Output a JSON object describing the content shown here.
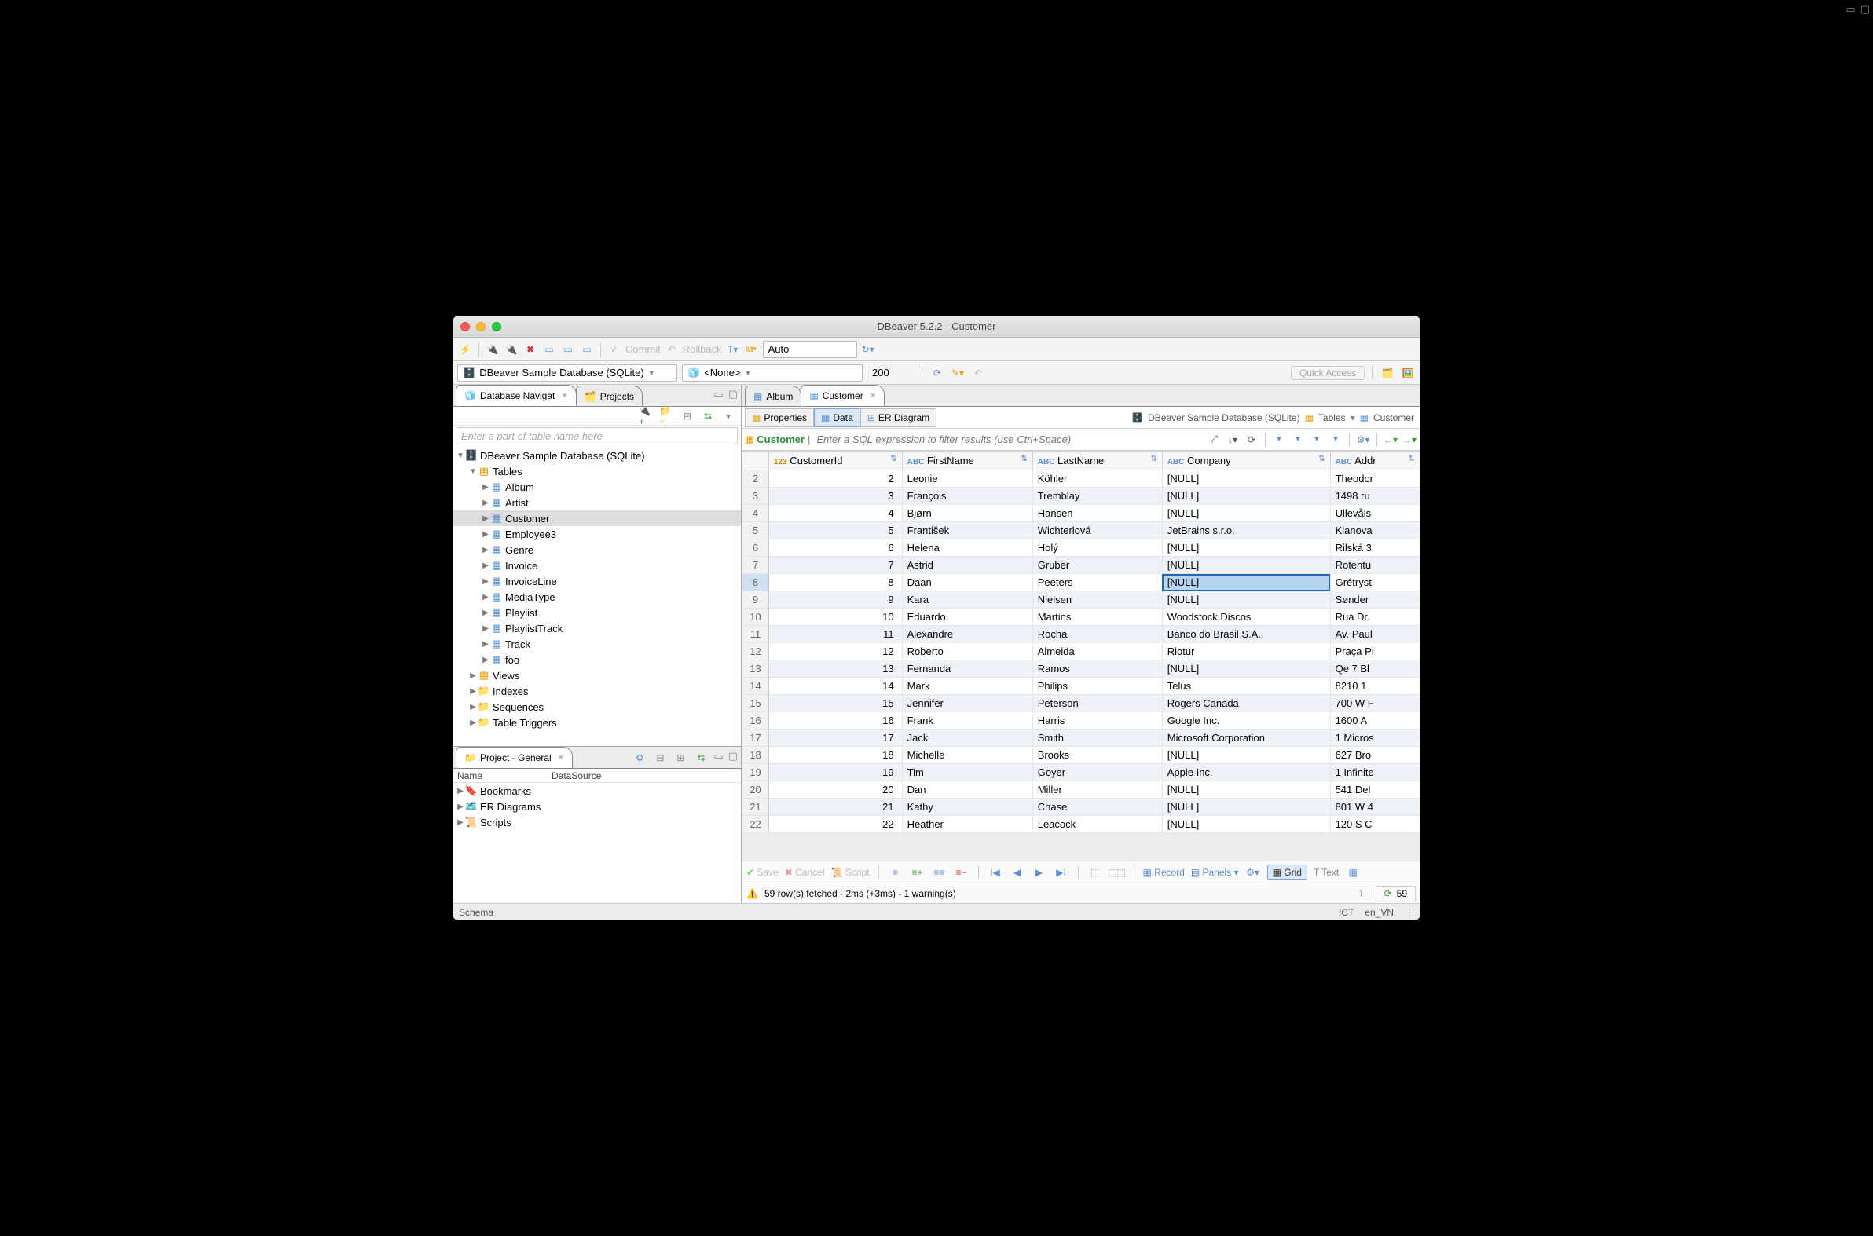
{
  "window": {
    "title": "DBeaver 5.2.2 - Customer"
  },
  "toolbar": {
    "commit": "Commit",
    "rollback": "Rollback",
    "tx_mode": "Auto",
    "datasource": "DBeaver Sample Database (SQLite)",
    "schema": "<None>",
    "fetch_size": "200",
    "quick_access": "Quick Access"
  },
  "nav": {
    "tab1": "Database Navigat",
    "tab2": "Projects",
    "search_ph": "Enter a part of table name here",
    "root": "DBeaver Sample Database (SQLite)",
    "tables_label": "Tables",
    "tables": [
      "Album",
      "Artist",
      "Customer",
      "Employee3",
      "Genre",
      "Invoice",
      "InvoiceLine",
      "MediaType",
      "Playlist",
      "PlaylistTrack",
      "Track",
      "foo"
    ],
    "views": "Views",
    "indexes": "Indexes",
    "sequences": "Sequences",
    "triggers": "Table Triggers"
  },
  "project": {
    "title": "Project - General",
    "col_name": "Name",
    "col_ds": "DataSource",
    "items": [
      "Bookmarks",
      "ER Diagrams",
      "Scripts"
    ]
  },
  "editor": {
    "tabs": [
      {
        "label": "Album",
        "active": false
      },
      {
        "label": "Customer",
        "active": true
      }
    ],
    "subtabs": {
      "properties": "Properties",
      "data": "Data",
      "er": "ER Diagram"
    },
    "breadcrumb": {
      "db": "DBeaver Sample Database (SQLite)",
      "tables": "Tables",
      "table": "Customer"
    },
    "filter_label": "Customer",
    "filter_ph": "Enter a SQL expression to filter results (use Ctrl+Space)"
  },
  "grid": {
    "columns": [
      "CustomerId",
      "FirstName",
      "LastName",
      "Company",
      "Addr"
    ],
    "col_types": [
      "123",
      "ABC",
      "ABC",
      "ABC",
      "ABC"
    ],
    "selected_row": 8,
    "selected_col": 3,
    "rows": [
      {
        "n": 2,
        "CustomerId": 2,
        "FirstName": "Leonie",
        "LastName": "Köhler",
        "Company": "[NULL]",
        "Addr": "Theodor"
      },
      {
        "n": 3,
        "CustomerId": 3,
        "FirstName": "François",
        "LastName": "Tremblay",
        "Company": "[NULL]",
        "Addr": "1498 ru"
      },
      {
        "n": 4,
        "CustomerId": 4,
        "FirstName": "Bjørn",
        "LastName": "Hansen",
        "Company": "[NULL]",
        "Addr": "Ullevåls"
      },
      {
        "n": 5,
        "CustomerId": 5,
        "FirstName": "František",
        "LastName": "Wichterlová",
        "Company": "JetBrains s.r.o.",
        "Addr": "Klanova"
      },
      {
        "n": 6,
        "CustomerId": 6,
        "FirstName": "Helena",
        "LastName": "Holý",
        "Company": "[NULL]",
        "Addr": "Rilská 3"
      },
      {
        "n": 7,
        "CustomerId": 7,
        "FirstName": "Astrid",
        "LastName": "Gruber",
        "Company": "[NULL]",
        "Addr": "Rotentu"
      },
      {
        "n": 8,
        "CustomerId": 8,
        "FirstName": "Daan",
        "LastName": "Peeters",
        "Company": "[NULL]",
        "Addr": "Grétryst"
      },
      {
        "n": 9,
        "CustomerId": 9,
        "FirstName": "Kara",
        "LastName": "Nielsen",
        "Company": "[NULL]",
        "Addr": "Sønder"
      },
      {
        "n": 10,
        "CustomerId": 10,
        "FirstName": "Eduardo",
        "LastName": "Martins",
        "Company": "Woodstock Discos",
        "Addr": "Rua Dr."
      },
      {
        "n": 11,
        "CustomerId": 11,
        "FirstName": "Alexandre",
        "LastName": "Rocha",
        "Company": "Banco do Brasil S.A.",
        "Addr": "Av. Paul"
      },
      {
        "n": 12,
        "CustomerId": 12,
        "FirstName": "Roberto",
        "LastName": "Almeida",
        "Company": "Riotur",
        "Addr": "Praça Pi"
      },
      {
        "n": 13,
        "CustomerId": 13,
        "FirstName": "Fernanda",
        "LastName": "Ramos",
        "Company": "[NULL]",
        "Addr": "Qe 7 Bl"
      },
      {
        "n": 14,
        "CustomerId": 14,
        "FirstName": "Mark",
        "LastName": "Philips",
        "Company": "Telus",
        "Addr": "8210 1"
      },
      {
        "n": 15,
        "CustomerId": 15,
        "FirstName": "Jennifer",
        "LastName": "Peterson",
        "Company": "Rogers Canada",
        "Addr": "700 W F"
      },
      {
        "n": 16,
        "CustomerId": 16,
        "FirstName": "Frank",
        "LastName": "Harris",
        "Company": "Google Inc.",
        "Addr": "1600 A"
      },
      {
        "n": 17,
        "CustomerId": 17,
        "FirstName": "Jack",
        "LastName": "Smith",
        "Company": "Microsoft Corporation",
        "Addr": "1 Micros"
      },
      {
        "n": 18,
        "CustomerId": 18,
        "FirstName": "Michelle",
        "LastName": "Brooks",
        "Company": "[NULL]",
        "Addr": "627 Bro"
      },
      {
        "n": 19,
        "CustomerId": 19,
        "FirstName": "Tim",
        "LastName": "Goyer",
        "Company": "Apple Inc.",
        "Addr": "1 Infinite"
      },
      {
        "n": 20,
        "CustomerId": 20,
        "FirstName": "Dan",
        "LastName": "Miller",
        "Company": "[NULL]",
        "Addr": "541 Del"
      },
      {
        "n": 21,
        "CustomerId": 21,
        "FirstName": "Kathy",
        "LastName": "Chase",
        "Company": "[NULL]",
        "Addr": "801 W 4"
      },
      {
        "n": 22,
        "CustomerId": 22,
        "FirstName": "Heather",
        "LastName": "Leacock",
        "Company": "[NULL]",
        "Addr": "120 S C"
      }
    ]
  },
  "footer": {
    "save": "Save",
    "cancel": "Cancel",
    "script": "Script",
    "record": "Record",
    "panels": "Panels",
    "grid": "Grid",
    "text": "Text",
    "fetch_msg": "59 row(s) fetched - 2ms (+3ms) - 1 warning(s)",
    "row_count": "59"
  },
  "status": {
    "left": "Schema",
    "tz": "ICT",
    "locale": "en_VN"
  }
}
